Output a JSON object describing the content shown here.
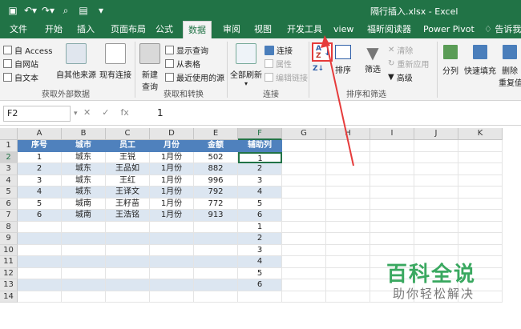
{
  "window": {
    "title": "隔行插入.xlsx - Excel"
  },
  "tabs": [
    {
      "label": "文件"
    },
    {
      "label": "开始"
    },
    {
      "label": "插入"
    },
    {
      "label": "页面布局"
    },
    {
      "label": "公式"
    },
    {
      "label": "数据",
      "active": true
    },
    {
      "label": "审阅"
    },
    {
      "label": "视图"
    },
    {
      "label": "开发工具"
    },
    {
      "label": "view"
    },
    {
      "label": "福昕阅读器"
    },
    {
      "label": "Power Pivot"
    },
    {
      "label": "告诉我你"
    }
  ],
  "ribbon": {
    "access": "自 Access",
    "web": "自网站",
    "text": "自文本",
    "other_sources": "自其他来源",
    "existing": "现有连接",
    "group_external": "获取外部数据",
    "new_query_1": "新建",
    "new_query_2": "查询",
    "show_queries": "显示查询",
    "from_table": "从表格",
    "recent_sources": "最近使用的源",
    "group_transform": "获取和转换",
    "refresh_all": "全部刷新",
    "connections": "连接",
    "properties": "属性",
    "edit_links": "编辑链接",
    "group_connections": "连接",
    "sort": "排序",
    "filter": "筛选",
    "clear": "清除",
    "reapply": "重新应用",
    "advanced": "高级",
    "group_sort_filter": "排序和筛选",
    "text_to_columns": "分列",
    "flash_fill": "快速填充",
    "remove_dup_1": "删除",
    "remove_dup_2": "重复值"
  },
  "formula_bar": {
    "name_box": "F2",
    "formula": "1",
    "fx": "fx"
  },
  "columns": [
    "A",
    "B",
    "C",
    "D",
    "E",
    "F",
    "G",
    "H",
    "I",
    "J",
    "K"
  ],
  "rows": [
    "1",
    "2",
    "3",
    "4",
    "5",
    "6",
    "7",
    "8",
    "9",
    "10",
    "11",
    "12",
    "13",
    "14"
  ],
  "table": {
    "headers": [
      "序号",
      "城市",
      "员工",
      "月份",
      "金额",
      "辅助列"
    ],
    "rows": [
      [
        "1",
        "城东",
        "王锐",
        "1月份",
        "502",
        "1"
      ],
      [
        "2",
        "城东",
        "王品如",
        "1月份",
        "882",
        "2"
      ],
      [
        "3",
        "城东",
        "王红",
        "1月份",
        "996",
        "3"
      ],
      [
        "4",
        "城东",
        "王译文",
        "1月份",
        "792",
        "4"
      ],
      [
        "5",
        "城南",
        "王籽苗",
        "1月份",
        "772",
        "5"
      ],
      [
        "6",
        "城南",
        "王浩铭",
        "1月份",
        "913",
        "6"
      ],
      [
        "",
        "",
        "",
        "",
        "",
        "1"
      ],
      [
        "",
        "",
        "",
        "",
        "",
        "2"
      ],
      [
        "",
        "",
        "",
        "",
        "",
        "3"
      ],
      [
        "",
        "",
        "",
        "",
        "",
        "4"
      ],
      [
        "",
        "",
        "",
        "",
        "",
        "5"
      ],
      [
        "",
        "",
        "",
        "",
        "",
        "6"
      ]
    ]
  },
  "watermark": {
    "line1": "百科全说",
    "line2": "助你轻松解决"
  },
  "colors": {
    "excel_green": "#217346",
    "header_blue": "#4f81bd",
    "band_blue": "#dce6f1",
    "highlight_red": "#e63b3b"
  }
}
